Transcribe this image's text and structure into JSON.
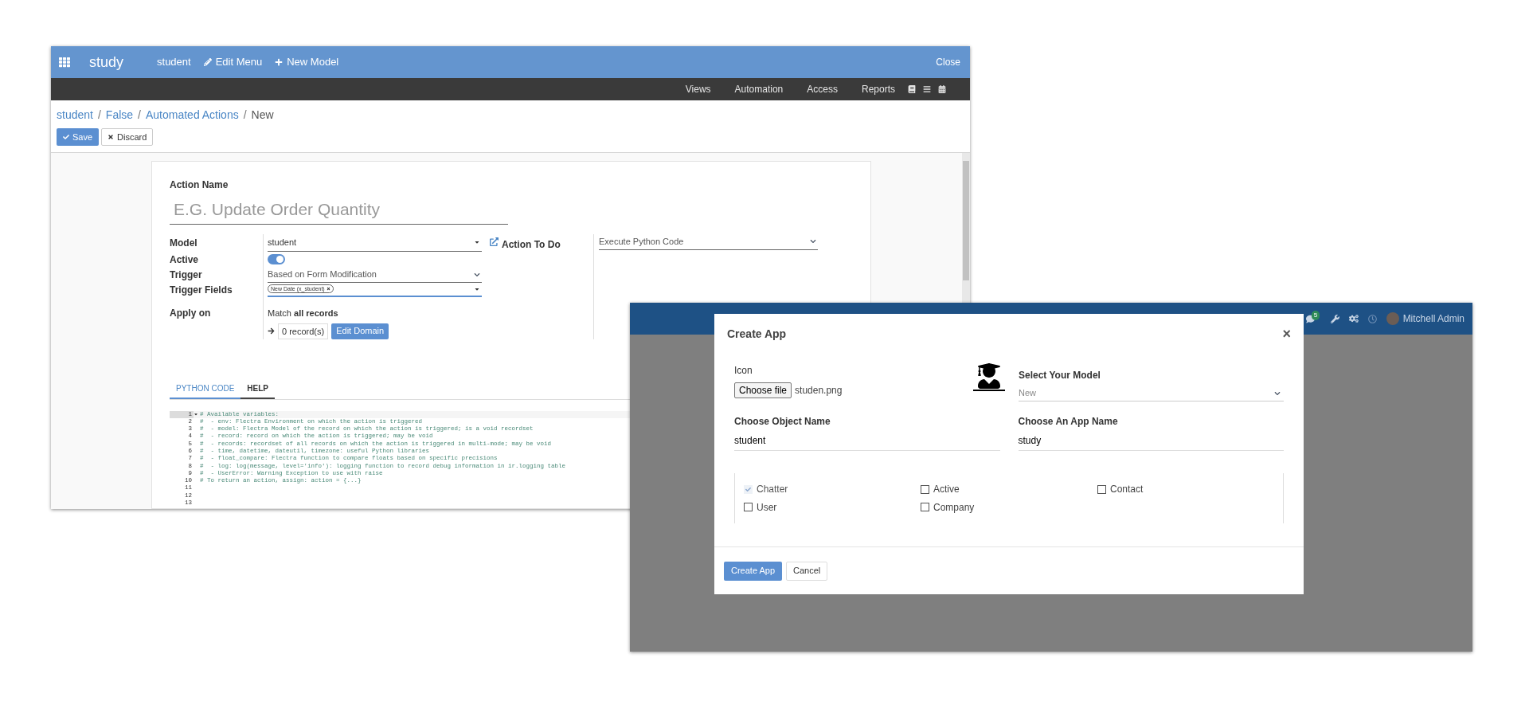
{
  "editor_window": {
    "top_bar": {
      "app_title": "study",
      "menu": [
        {
          "label": "student"
        },
        {
          "label": "Edit Menu"
        },
        {
          "label": "New Model"
        }
      ],
      "close": "Close"
    },
    "sub_bar": {
      "items": [
        "Views",
        "Automation",
        "Access",
        "Reports"
      ]
    },
    "breadcrumb": [
      {
        "label": "student",
        "link": true
      },
      {
        "separator": "/",
        "label": "False",
        "link": true
      },
      {
        "separator": "/",
        "label": "Automated Actions",
        "link": true
      },
      {
        "separator": "/",
        "label": "New",
        "link": false
      }
    ],
    "buttons": {
      "save": "Save",
      "discard": "Discard"
    },
    "form": {
      "action_name_label": "Action Name",
      "action_name_placeholder": "E.G. Update Order Quantity",
      "model_label": "Model",
      "model_value": "student",
      "action_to_do_label": "Action To Do",
      "action_to_do_value": "Execute Python Code",
      "active_label": "Active",
      "active_on": true,
      "trigger_label": "Trigger",
      "trigger_value": "Based on Form Modification",
      "trigger_fields_label": "Trigger Fields",
      "trigger_fields_tag": "New Date (x_student)",
      "apply_on_label": "Apply on",
      "apply_on_text": "Match **all records**",
      "records": "0 record(s)",
      "edit_domain": "Edit Domain"
    },
    "tabs": [
      {
        "label": "PYTHON CODE",
        "selected": true
      },
      {
        "label": "HELP",
        "selected": false
      }
    ],
    "code": [
      {
        "number": "1",
        "text": "# Available variables:"
      },
      {
        "number": "2",
        "text": "#  - env: Flectra Environment on which the action is triggered"
      },
      {
        "number": "3",
        "text": "#  - model: Flectra Model of the record on which the action is triggered; is a void recordset"
      },
      {
        "number": "4",
        "text": "#  - record: record on which the action is triggered; may be void"
      },
      {
        "number": "5",
        "text": "#  - records: recordset of all records on which the action is triggered in multi-mode; may be void"
      },
      {
        "number": "6",
        "text": "#  - time, datetime, dateutil, timezone: useful Python libraries"
      },
      {
        "number": "7",
        "text": "#  - float_compare: Flectra function to compare floats based on specific precisions"
      },
      {
        "number": "8",
        "text": "#  - log: log(message, level='info'): logging function to record debug information in ir.logging table"
      },
      {
        "number": "9",
        "text": "#  - UserError: Warning Exception to use with raise"
      },
      {
        "number": "10",
        "text": "# To return an action, assign: action = {...}"
      },
      {
        "number": "11"
      },
      {
        "number": "12"
      },
      {
        "number": "13"
      }
    ]
  },
  "app_window": {
    "top_bar": {
      "chat_count": "5",
      "user": "Mitchell Admin"
    },
    "dialog": {
      "title": "Create App",
      "close": "×",
      "icon_label": "Icon",
      "choose_file": "Choose file",
      "file_name": "studen.png",
      "model_label": "Select Your Model",
      "model_value": "New",
      "object_name_label": "Choose Object Name",
      "object_name_value": "student",
      "app_name_label": "Choose An App Name",
      "app_name_value": "study",
      "options": [
        {
          "label": "Chatter",
          "checked": true,
          "disabled": true
        },
        {
          "label": "Active",
          "checked": false,
          "disabled": false
        },
        {
          "label": "Contact",
          "checked": false,
          "disabled": false
        },
        {
          "label": "User",
          "checked": false,
          "disabled": false
        },
        {
          "label": "Company",
          "checked": false,
          "disabled": false
        }
      ],
      "create": "Create App",
      "cancel": "Cancel"
    }
  }
}
